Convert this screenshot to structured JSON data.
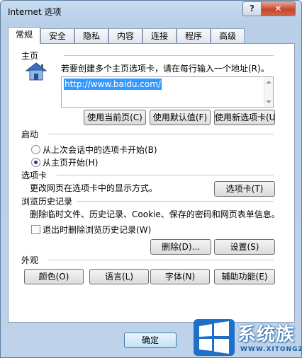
{
  "window": {
    "title": "Internet 选项",
    "help_label": "?",
    "close_label": "✕"
  },
  "tabs": [
    "常规",
    "安全",
    "隐私",
    "内容",
    "连接",
    "程序",
    "高级"
  ],
  "homepage": {
    "section": "主页",
    "description": "若要创建多个主页选项卡，请在每行输入一个地址(R)。",
    "url": "http://www.baidu.com/",
    "buttons": [
      "使用当前页(C)",
      "使用默认值(F)",
      "使用新选项卡(U)"
    ],
    "icon": "house-icon"
  },
  "startup": {
    "section": "启动",
    "options": [
      {
        "label": "从上次会话中的选项卡开始(B)",
        "selected": false
      },
      {
        "label": "从主页开始(H)",
        "selected": true
      }
    ]
  },
  "tabs_section": {
    "section": "选项卡",
    "description": "更改网页在选项卡中的显示方式。",
    "button": "选项卡(T)"
  },
  "history": {
    "section": "浏览历史记录",
    "description": "删除临时文件、历史记录、Cookie、保存的密码和网页表单信息。",
    "checkbox_label": "退出时删除浏览历史记录(W)",
    "checkbox_checked": false,
    "delete_button": "删除(D)...",
    "settings_button": "设置(S)"
  },
  "appearance": {
    "section": "外观",
    "buttons": [
      "颜色(O)",
      "语言(L)",
      "字体(N)",
      "辅助功能(E)"
    ]
  },
  "footer": {
    "ok_label": "确定"
  },
  "watermark": {
    "text": "系统族",
    "url": "WWW.XITONGZU.COM"
  },
  "colors": {
    "selection": "#3399ff",
    "window_frame": "#bed3ea"
  }
}
